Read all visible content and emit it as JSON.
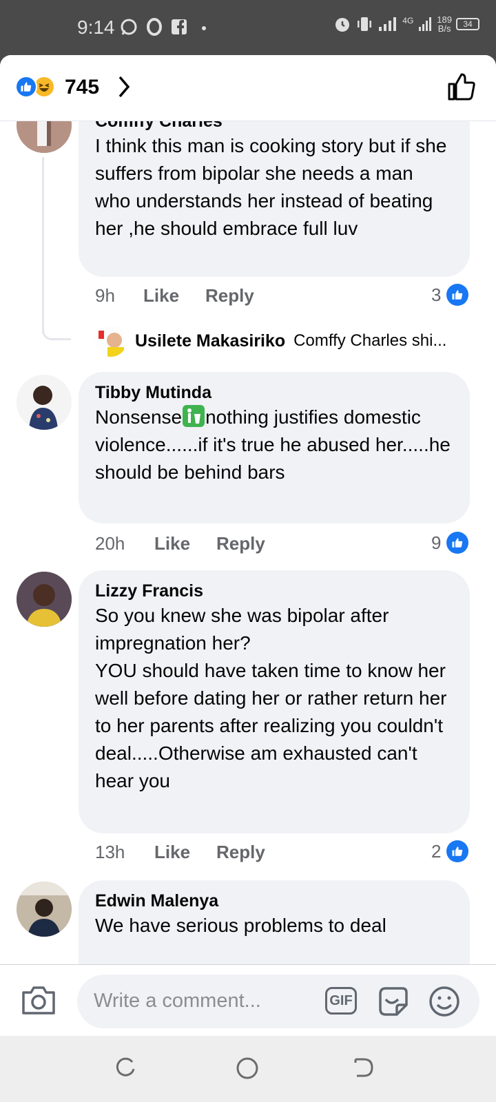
{
  "status_bar": {
    "time": "9:14",
    "network": "4G",
    "net_speed_value": "189",
    "net_speed_unit": "B/s",
    "battery": "34"
  },
  "reactions": {
    "count": "745",
    "types": [
      "like-icon",
      "haha-icon"
    ]
  },
  "comments": [
    {
      "author": "Comffy Charles",
      "text": "I think this man is cooking story but if she suffers from bipolar she needs a man who understands her instead of beating her ,he should embrace full luv",
      "time": "9h",
      "like_label": "Like",
      "reply_label": "Reply",
      "likes": "3",
      "reply_preview": {
        "author": "Usilete Makasiriko",
        "snippet": "Comffy Charles shi..."
      }
    },
    {
      "author": "Tibby Mutinda",
      "text_before_emoji": "Nonsense",
      "text_after_emoji": "nothing justifies domestic violence......if it's true he abused her.....he should be behind bars",
      "time": "20h",
      "like_label": "Like",
      "reply_label": "Reply",
      "likes": "9"
    },
    {
      "author": "Lizzy Francis",
      "text": "So you knew she was bipolar after impregnation her?\nYOU should have taken time to know her well before dating her or rather return her to her parents after realizing you couldn't deal.....Otherwise am exhausted can't hear you",
      "time": "13h",
      "like_label": "Like",
      "reply_label": "Reply",
      "likes": "2"
    },
    {
      "author": "Edwin Malenya",
      "text": "We have serious problems to deal"
    }
  ],
  "composer": {
    "placeholder": "Write a comment...",
    "gif_label": "GIF"
  },
  "colors": {
    "brand_blue": "#1877f2",
    "bubble_gray": "#f0f2f5",
    "meta_gray": "#65676b"
  }
}
